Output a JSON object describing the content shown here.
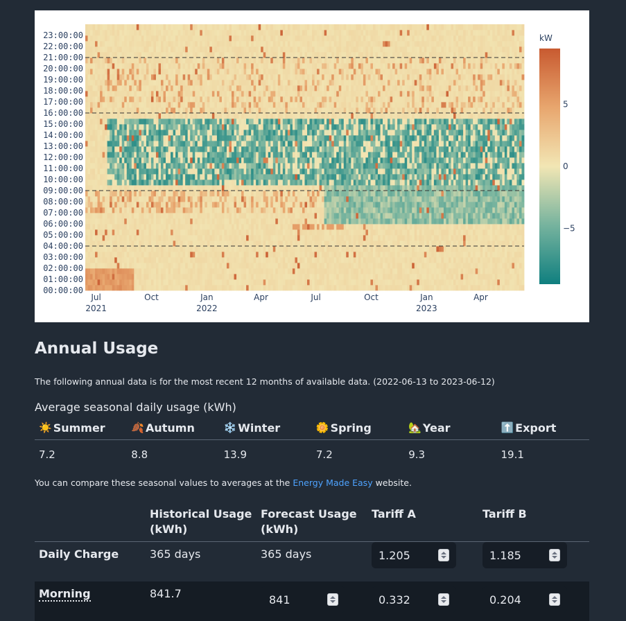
{
  "chart_data": {
    "type": "heatmap",
    "colorbar_title": "kW",
    "colorbar_ticks": [
      "5",
      "0",
      "−5"
    ],
    "colorbar_tick_values": [
      5,
      0,
      -5
    ],
    "zlim": [
      -9.5,
      9.5
    ],
    "y_ticks": [
      "00:00:00",
      "01:00:00",
      "02:00:00",
      "03:00:00",
      "04:00:00",
      "05:00:00",
      "06:00:00",
      "07:00:00",
      "08:00:00",
      "09:00:00",
      "10:00:00",
      "11:00:00",
      "12:00:00",
      "13:00:00",
      "14:00:00",
      "15:00:00",
      "16:00:00",
      "17:00:00",
      "18:00:00",
      "19:00:00",
      "20:00:00",
      "21:00:00",
      "22:00:00",
      "23:00:00"
    ],
    "x_ticks": [
      {
        "label": "Jul",
        "year": "2021",
        "date": "2021-07-01"
      },
      {
        "label": "Oct",
        "year": "",
        "date": "2021-10-01"
      },
      {
        "label": "Jan",
        "year": "2022",
        "date": "2022-01-01"
      },
      {
        "label": "Apr",
        "year": "",
        "date": "2022-04-01"
      },
      {
        "label": "Jul",
        "year": "",
        "date": "2022-07-01"
      },
      {
        "label": "Oct",
        "year": "",
        "date": "2022-10-01"
      },
      {
        "label": "Jan",
        "year": "2023",
        "date": "2023-01-01"
      },
      {
        "label": "Apr",
        "year": "",
        "date": "2023-04-01"
      }
    ],
    "x_range": [
      "2021-06-13",
      "2023-06-12"
    ],
    "y_range": [
      "00:00:00",
      "24:00:00"
    ],
    "reference_lines_hours": [
      4,
      9,
      16,
      21
    ],
    "palette": [
      "#0f7f7f",
      "#f2e6b4",
      "#c85a30"
    ]
  },
  "annual": {
    "title": "Annual Usage",
    "intro": "The following annual data is for the most recent 12 months of available data. (2022-06-13 to 2023-06-12)",
    "subheading": "Average seasonal daily usage (kWh)",
    "seasons": [
      {
        "icon": "☀️",
        "name": "Summer",
        "value": "7.2"
      },
      {
        "icon": "🍂",
        "name": "Autumn",
        "value": "8.8"
      },
      {
        "icon": "❄️",
        "name": "Winter",
        "value": "13.9"
      },
      {
        "icon": "🌼",
        "name": "Spring",
        "value": "7.2"
      },
      {
        "icon": "🏡",
        "name": "Year",
        "value": "9.3"
      },
      {
        "icon": "⬆️",
        "name": "Export",
        "value": "19.1"
      }
    ],
    "compare_prefix": "You can compare these seasonal values to averages at the ",
    "compare_link": "Energy Made Easy",
    "compare_suffix": " website."
  },
  "tariff_table": {
    "headers": [
      "",
      "Historical Usage (kWh)",
      "Forecast Usage (kWh)",
      "Tariff A",
      "Tariff B"
    ],
    "header_lines": [
      [
        "",
        ""
      ],
      [
        "Historical Usage",
        "(kWh)"
      ],
      [
        "Forecast Usage",
        "(kWh)"
      ],
      [
        "Tariff A",
        ""
      ],
      [
        "Tariff B",
        ""
      ]
    ],
    "rows": [
      {
        "label": "Daily Charge",
        "historical": "365 days",
        "forecast": "365 days",
        "tariff_a": "1.205",
        "tariff_b": "1.185"
      },
      {
        "label": "Morning",
        "historical": "841.7",
        "forecast": "841",
        "tariff_a": "0.332",
        "tariff_b": "0.204"
      }
    ]
  }
}
